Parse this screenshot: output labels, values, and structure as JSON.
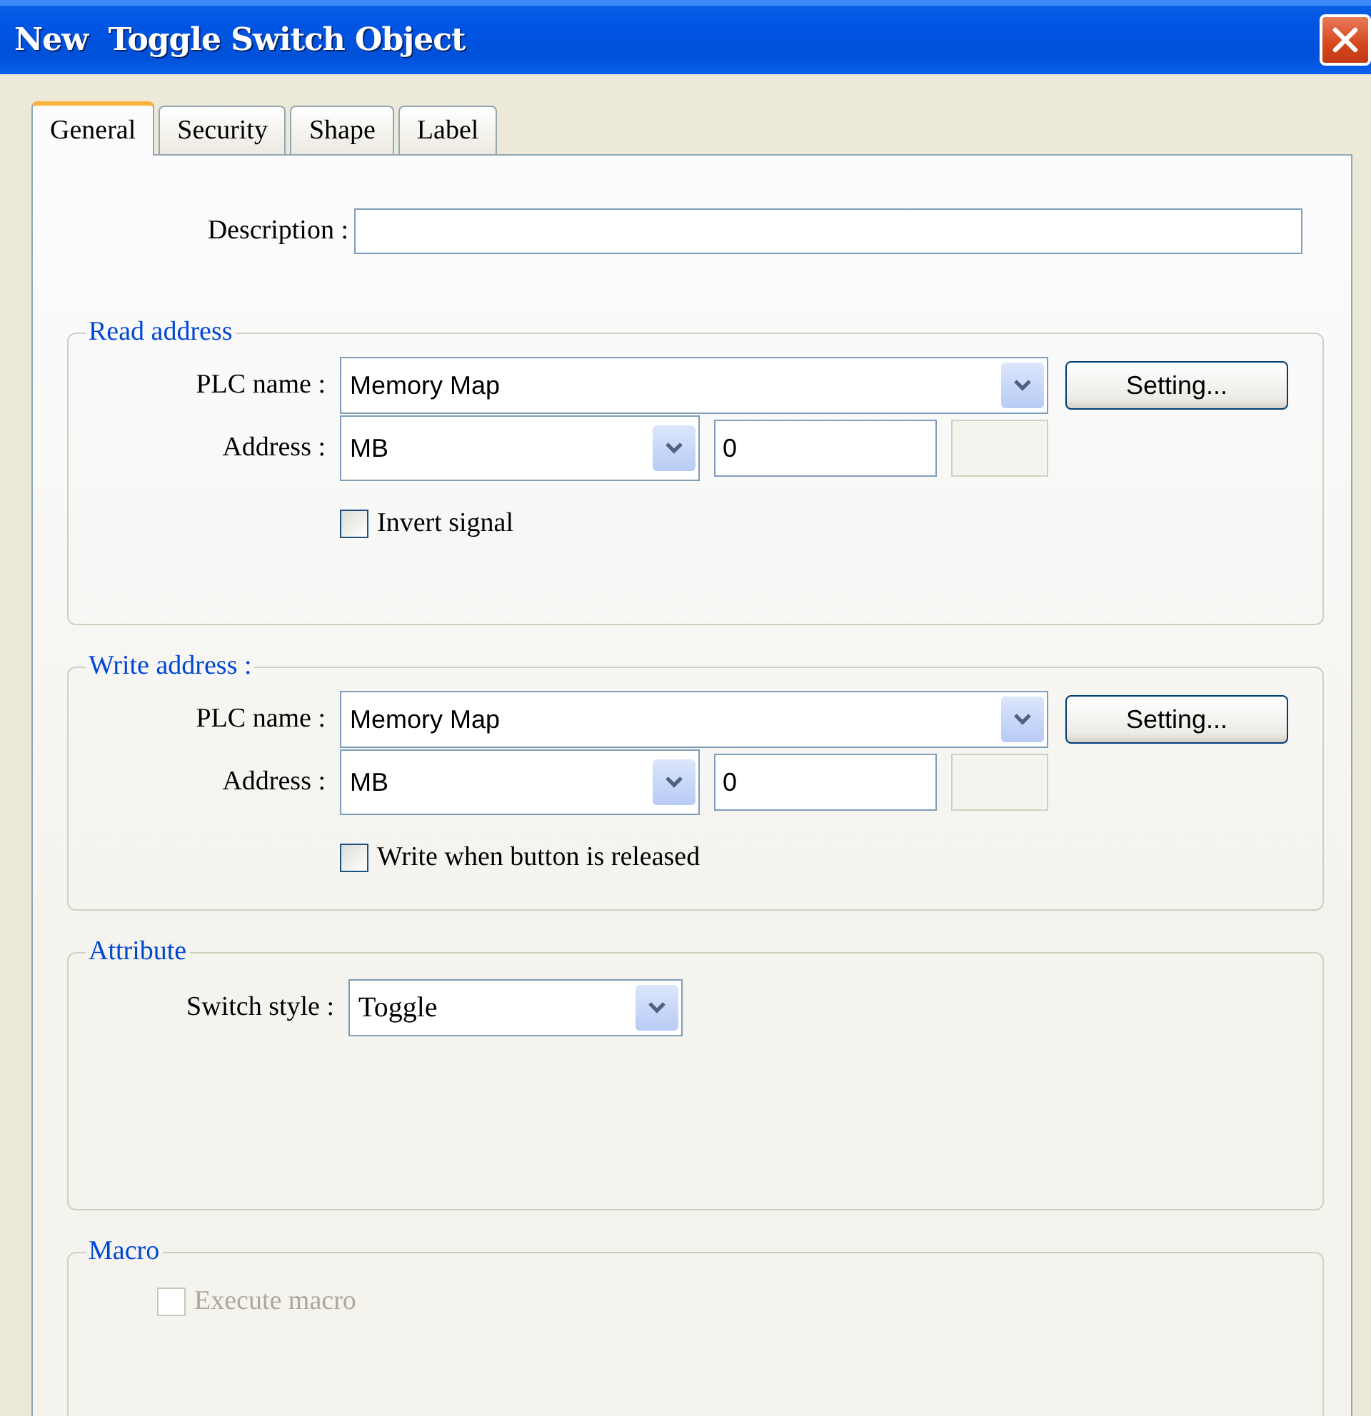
{
  "window": {
    "title": "New  Toggle Switch Object"
  },
  "tabs": [
    {
      "label": "General",
      "selected": true
    },
    {
      "label": "Security",
      "selected": false
    },
    {
      "label": "Shape",
      "selected": false
    },
    {
      "label": "Label",
      "selected": false
    }
  ],
  "description": {
    "label": "Description :"
  },
  "sections": [
    {
      "kind": "address",
      "title": "Read address",
      "plc_label": "PLC name :",
      "plc_value": "Memory Map",
      "setting_button": "Setting...",
      "address_label": "Address :",
      "device": "MB",
      "address_value": "0",
      "checkbox": {
        "label": "Invert signal",
        "checked": false,
        "disabled": false
      }
    },
    {
      "kind": "address",
      "title": "Write address :",
      "plc_label": "PLC name :",
      "plc_value": "Memory Map",
      "setting_button": "Setting...",
      "address_label": "Address :",
      "device": "MB",
      "address_value": "0",
      "checkbox": {
        "label": "Write when button is released",
        "checked": false,
        "disabled": false
      }
    },
    {
      "kind": "attribute",
      "title": "Attribute",
      "style_label": "Switch style :",
      "style_value": "Toggle"
    },
    {
      "kind": "macro",
      "title": "Macro",
      "checkbox": {
        "label": "Execute macro",
        "checked": false,
        "disabled": true
      }
    }
  ]
}
